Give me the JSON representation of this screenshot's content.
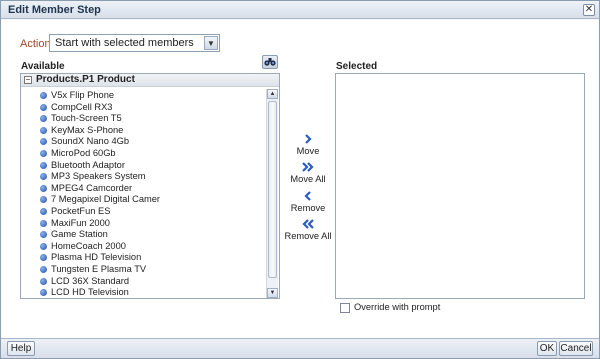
{
  "dialog": {
    "title": "Edit Member Step",
    "close_icon": "close-icon"
  },
  "action": {
    "label": "Action",
    "selected": "Start with selected members"
  },
  "available": {
    "label": "Available",
    "find_icon": "binoculars-icon",
    "tree_header": "Products.P1  Product",
    "items": [
      "V5x Flip Phone",
      "CompCell RX3",
      "Touch-Screen T5",
      "KeyMax S-Phone",
      "SoundX Nano 4Gb",
      "MicroPod 60Gb",
      "Bluetooth Adaptor",
      "MP3 Speakers System",
      "MPEG4 Camcorder",
      "7 Megapixel Digital Camer",
      "PocketFun ES",
      "MaxiFun 2000",
      "Game Station",
      "HomeCoach 2000",
      "Plasma HD Television",
      "Tungsten E Plasma TV",
      "LCD 36X Standard",
      "LCD HD Television"
    ]
  },
  "move_buttons": {
    "move": "Move",
    "move_all": "Move All",
    "remove": "Remove",
    "remove_all": "Remove All"
  },
  "selected": {
    "label": "Selected"
  },
  "override": {
    "label": "Override with prompt",
    "checked": false
  },
  "footer": {
    "help": "Help",
    "ok": "OK",
    "cancel": "Cancel"
  },
  "colors": {
    "action_label": "#a0462a",
    "arrow_blue": "#2a5cc4",
    "bullet_blue": "#1e4fa8"
  }
}
